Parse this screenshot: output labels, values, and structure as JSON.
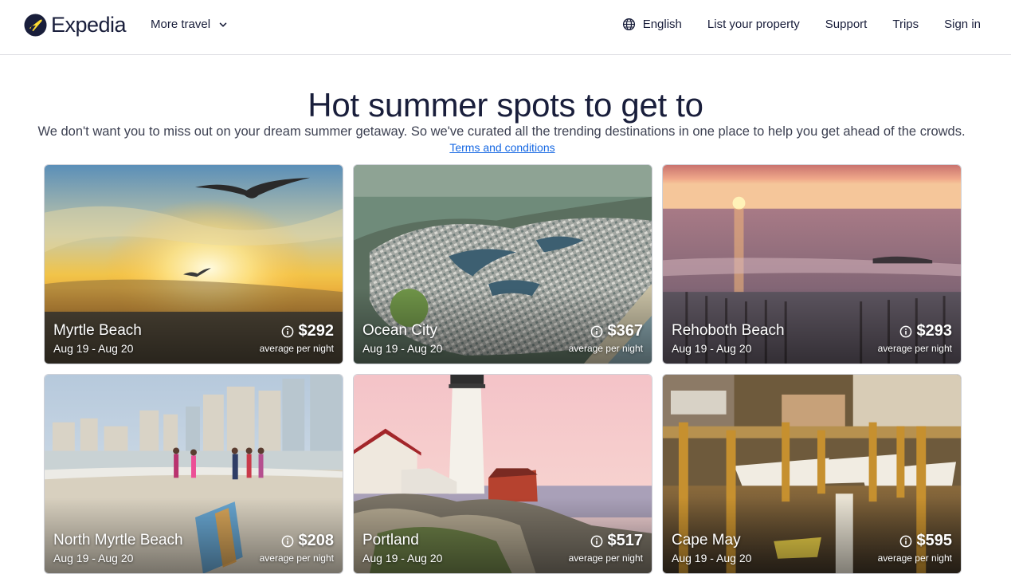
{
  "header": {
    "brand": "Expedia",
    "more_travel": "More travel",
    "language": "English",
    "list_property": "List your property",
    "support": "Support",
    "trips": "Trips",
    "sign_in": "Sign in"
  },
  "hero": {
    "title": "Hot summer spots to get to",
    "subtitle": "We don't want you to miss out on your dream summer getaway. So we've curated all the trending destinations in one place to help you get ahead of the crowds.",
    "terms": "Terms and conditions"
  },
  "destinations": [
    {
      "name": "Myrtle Beach",
      "dates": "Aug 19 - Aug 20",
      "price": "$292",
      "price_note": "average per night"
    },
    {
      "name": "Ocean City",
      "dates": "Aug 19 - Aug 20",
      "price": "$367",
      "price_note": "average per night"
    },
    {
      "name": "Rehoboth Beach",
      "dates": "Aug 19 - Aug 20",
      "price": "$293",
      "price_note": "average per night"
    },
    {
      "name": "North Myrtle Beach",
      "dates": "Aug 19 - Aug 20",
      "price": "$208",
      "price_note": "average per night"
    },
    {
      "name": "Portland",
      "dates": "Aug 19 - Aug 20",
      "price": "$517",
      "price_note": "average per night"
    },
    {
      "name": "Cape May",
      "dates": "Aug 19 - Aug 20",
      "price": "$595",
      "price_note": "average per night"
    }
  ],
  "icons": {
    "logo": "expedia-plane-icon",
    "dropdown": "chevron-down-icon",
    "language": "globe-icon",
    "price_info": "info-icon"
  },
  "colors": {
    "brand_navy": "#191e3b",
    "link_blue": "#1668e3",
    "logo_yellow": "#fddb32"
  }
}
